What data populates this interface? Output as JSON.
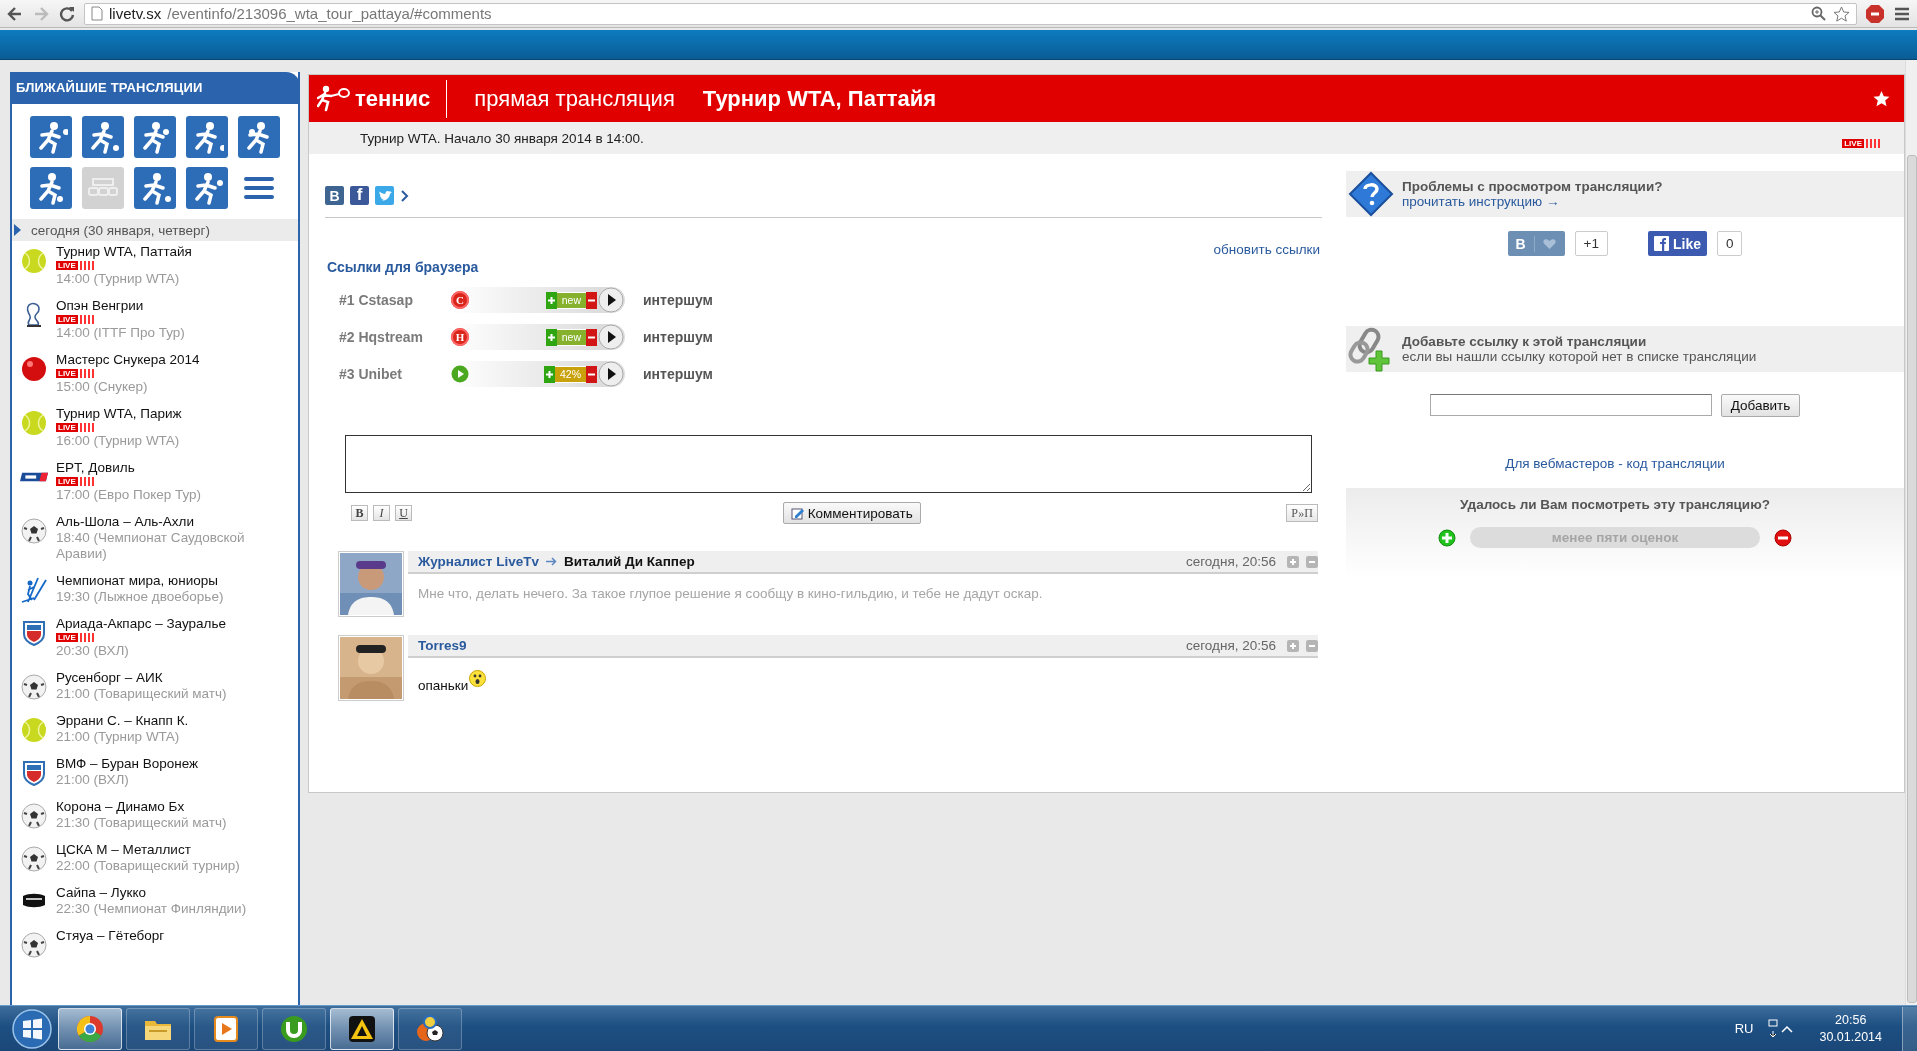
{
  "browser": {
    "url_host": "livetv.sx",
    "url_path": "/eventinfo/213096_wta_tour_pattaya/#comments"
  },
  "sidebar": {
    "title": "БЛИЖАЙШИЕ ТРАНСЛЯЦИИ",
    "sports": [
      {
        "kind": "figure"
      },
      {
        "kind": "figure"
      },
      {
        "kind": "figure"
      },
      {
        "kind": "figure"
      },
      {
        "kind": "figure"
      },
      {
        "kind": "figure"
      },
      {
        "kind": "table"
      },
      {
        "kind": "figure"
      },
      {
        "kind": "figure"
      },
      {
        "kind": "menu"
      }
    ],
    "date": "сегодня (30 января, четверг)",
    "events": [
      {
        "kind": "tennis",
        "title": "Турнир WTA, Паттайя",
        "live": "LIVE",
        "subtitle": "14:00 (Турнир WTA)"
      },
      {
        "kind": "ittf",
        "title": "Опэн Венгрии",
        "live": "LIVE",
        "subtitle": "14:00 (ITTF Про Тур)"
      },
      {
        "kind": "snooker",
        "title": "Мастерс Снукера 2014",
        "live": "LIVE",
        "subtitle": "15:00 (Снукер)"
      },
      {
        "kind": "tennis",
        "title": "Турнир WTA, Париж",
        "live": "LIVE",
        "subtitle": "16:00 (Турнир WTA)"
      },
      {
        "kind": "poker",
        "title": "EPT, Довиль",
        "live": "LIVE",
        "subtitle": "17:00 (Евро Покер Тур)"
      },
      {
        "kind": "football",
        "title": "Аль-Шола – Аль-Ахли",
        "subtitle": "18:40 (Чемпионат Саудовской Аравии)"
      },
      {
        "kind": "skiing",
        "title": "Чемпионат мира, юниоры",
        "subtitle": "19:30 (Лыжное двоеборье)"
      },
      {
        "kind": "hockey",
        "title": "Ариада-Акпарс – Зауралье",
        "live": "LIVE",
        "subtitle": "20:30 (ВХЛ)"
      },
      {
        "kind": "football",
        "title": "Русенборг – АИК",
        "subtitle": "21:00 (Товарищеский матч)"
      },
      {
        "kind": "tennis",
        "title": "Эррани С. – Кнапп К.",
        "subtitle": "21:00 (Турнир WTA)"
      },
      {
        "kind": "hockey",
        "title": "ВМФ – Буран Воронеж",
        "subtitle": "21:00 (ВХЛ)"
      },
      {
        "kind": "football",
        "title": "Корона – Динамо Бх",
        "subtitle": "21:30 (Товарищеский матч)"
      },
      {
        "kind": "football",
        "title": "ЦСКА М – Металлист",
        "subtitle": "22:00 (Товарищеский турнир)"
      },
      {
        "kind": "liiga",
        "title": "Сайпа – Лукко",
        "subtitle": "22:30 (Чемпионат Финляндии)"
      },
      {
        "kind": "football",
        "title": "Стяуа – Гётеборг"
      }
    ]
  },
  "main": {
    "header": {
      "sport": "теннис",
      "subtitle": "прямая трансляция",
      "title": "Турнир WTA, Паттайя"
    },
    "info": "Турнир WTA. Начало 30 января 2014 в 14:00.",
    "live": "LIVE",
    "share": [
      {
        "kind": "vk",
        "glyph": "В"
      },
      {
        "kind": "facebook",
        "glyph": "f"
      },
      {
        "kind": "twitter"
      }
    ],
    "refresh": "обновить ссылки",
    "links_title": "Ссылки для браузера",
    "links": [
      {
        "label": "#1 Cstasap",
        "kind": "letter",
        "badge": "C",
        "rating": {
          "kind": "new",
          "label": "new"
        },
        "source": "интершум"
      },
      {
        "label": "#2 Hqstream",
        "kind": "letter",
        "badge": "H",
        "rating": {
          "kind": "new",
          "label": "new"
        },
        "source": "интершум"
      },
      {
        "label": "#3 Unibet",
        "kind": "play",
        "rating": {
          "kind": "percent",
          "label": "42%"
        },
        "source": "интершум"
      }
    ],
    "format_buttons": [
      {
        "kind": "bold",
        "label": "B"
      },
      {
        "kind": "italic",
        "label": "I"
      },
      {
        "kind": "underline",
        "label": "U"
      }
    ],
    "submit": "Комментировать",
    "translit": "Р»П",
    "comments": [
      {
        "author": "Журналист LiveTv",
        "reply_to": "Виталий Ди Каппер",
        "time": "сегодня, 20:56",
        "text": "Мне что, делать нечего. За такое глупое решение я сообщу в кино-гильдию, и тебе не дадут оскар.",
        "faded": true,
        "smiley": false
      },
      {
        "author": "Torres9",
        "time": "сегодня, 20:56",
        "text": "опаньки",
        "faded": false,
        "smiley": true
      }
    ]
  },
  "right": {
    "help_title": "Проблемы с просмотром трансляции?",
    "help_link": "прочитать инструкцию →",
    "vk_glyph": "В",
    "vk_count": "+1",
    "fb_label": "Like",
    "fb_count": "0",
    "add_title": "Добавьте ссылку к этой трансляции",
    "add_text": "если вы нашли ссылку которой нет в списке трансляции",
    "add_button": "Добавить",
    "webmaster": "Для вебмастеров - код трансляции",
    "question": "Удалось ли Вам посмотреть эту трансляцию?",
    "rating_status": "менее пяти оценок"
  },
  "taskbar": {
    "apps": [
      {
        "kind": "chrome",
        "active": true
      },
      {
        "kind": "folder",
        "active": false
      },
      {
        "kind": "media",
        "active": false
      },
      {
        "kind": "torrent",
        "active": false
      },
      {
        "kind": "player",
        "active": true
      },
      {
        "kind": "sports",
        "active": false
      }
    ],
    "language": "RU",
    "time": "20:56",
    "date": "30.01.2014"
  }
}
